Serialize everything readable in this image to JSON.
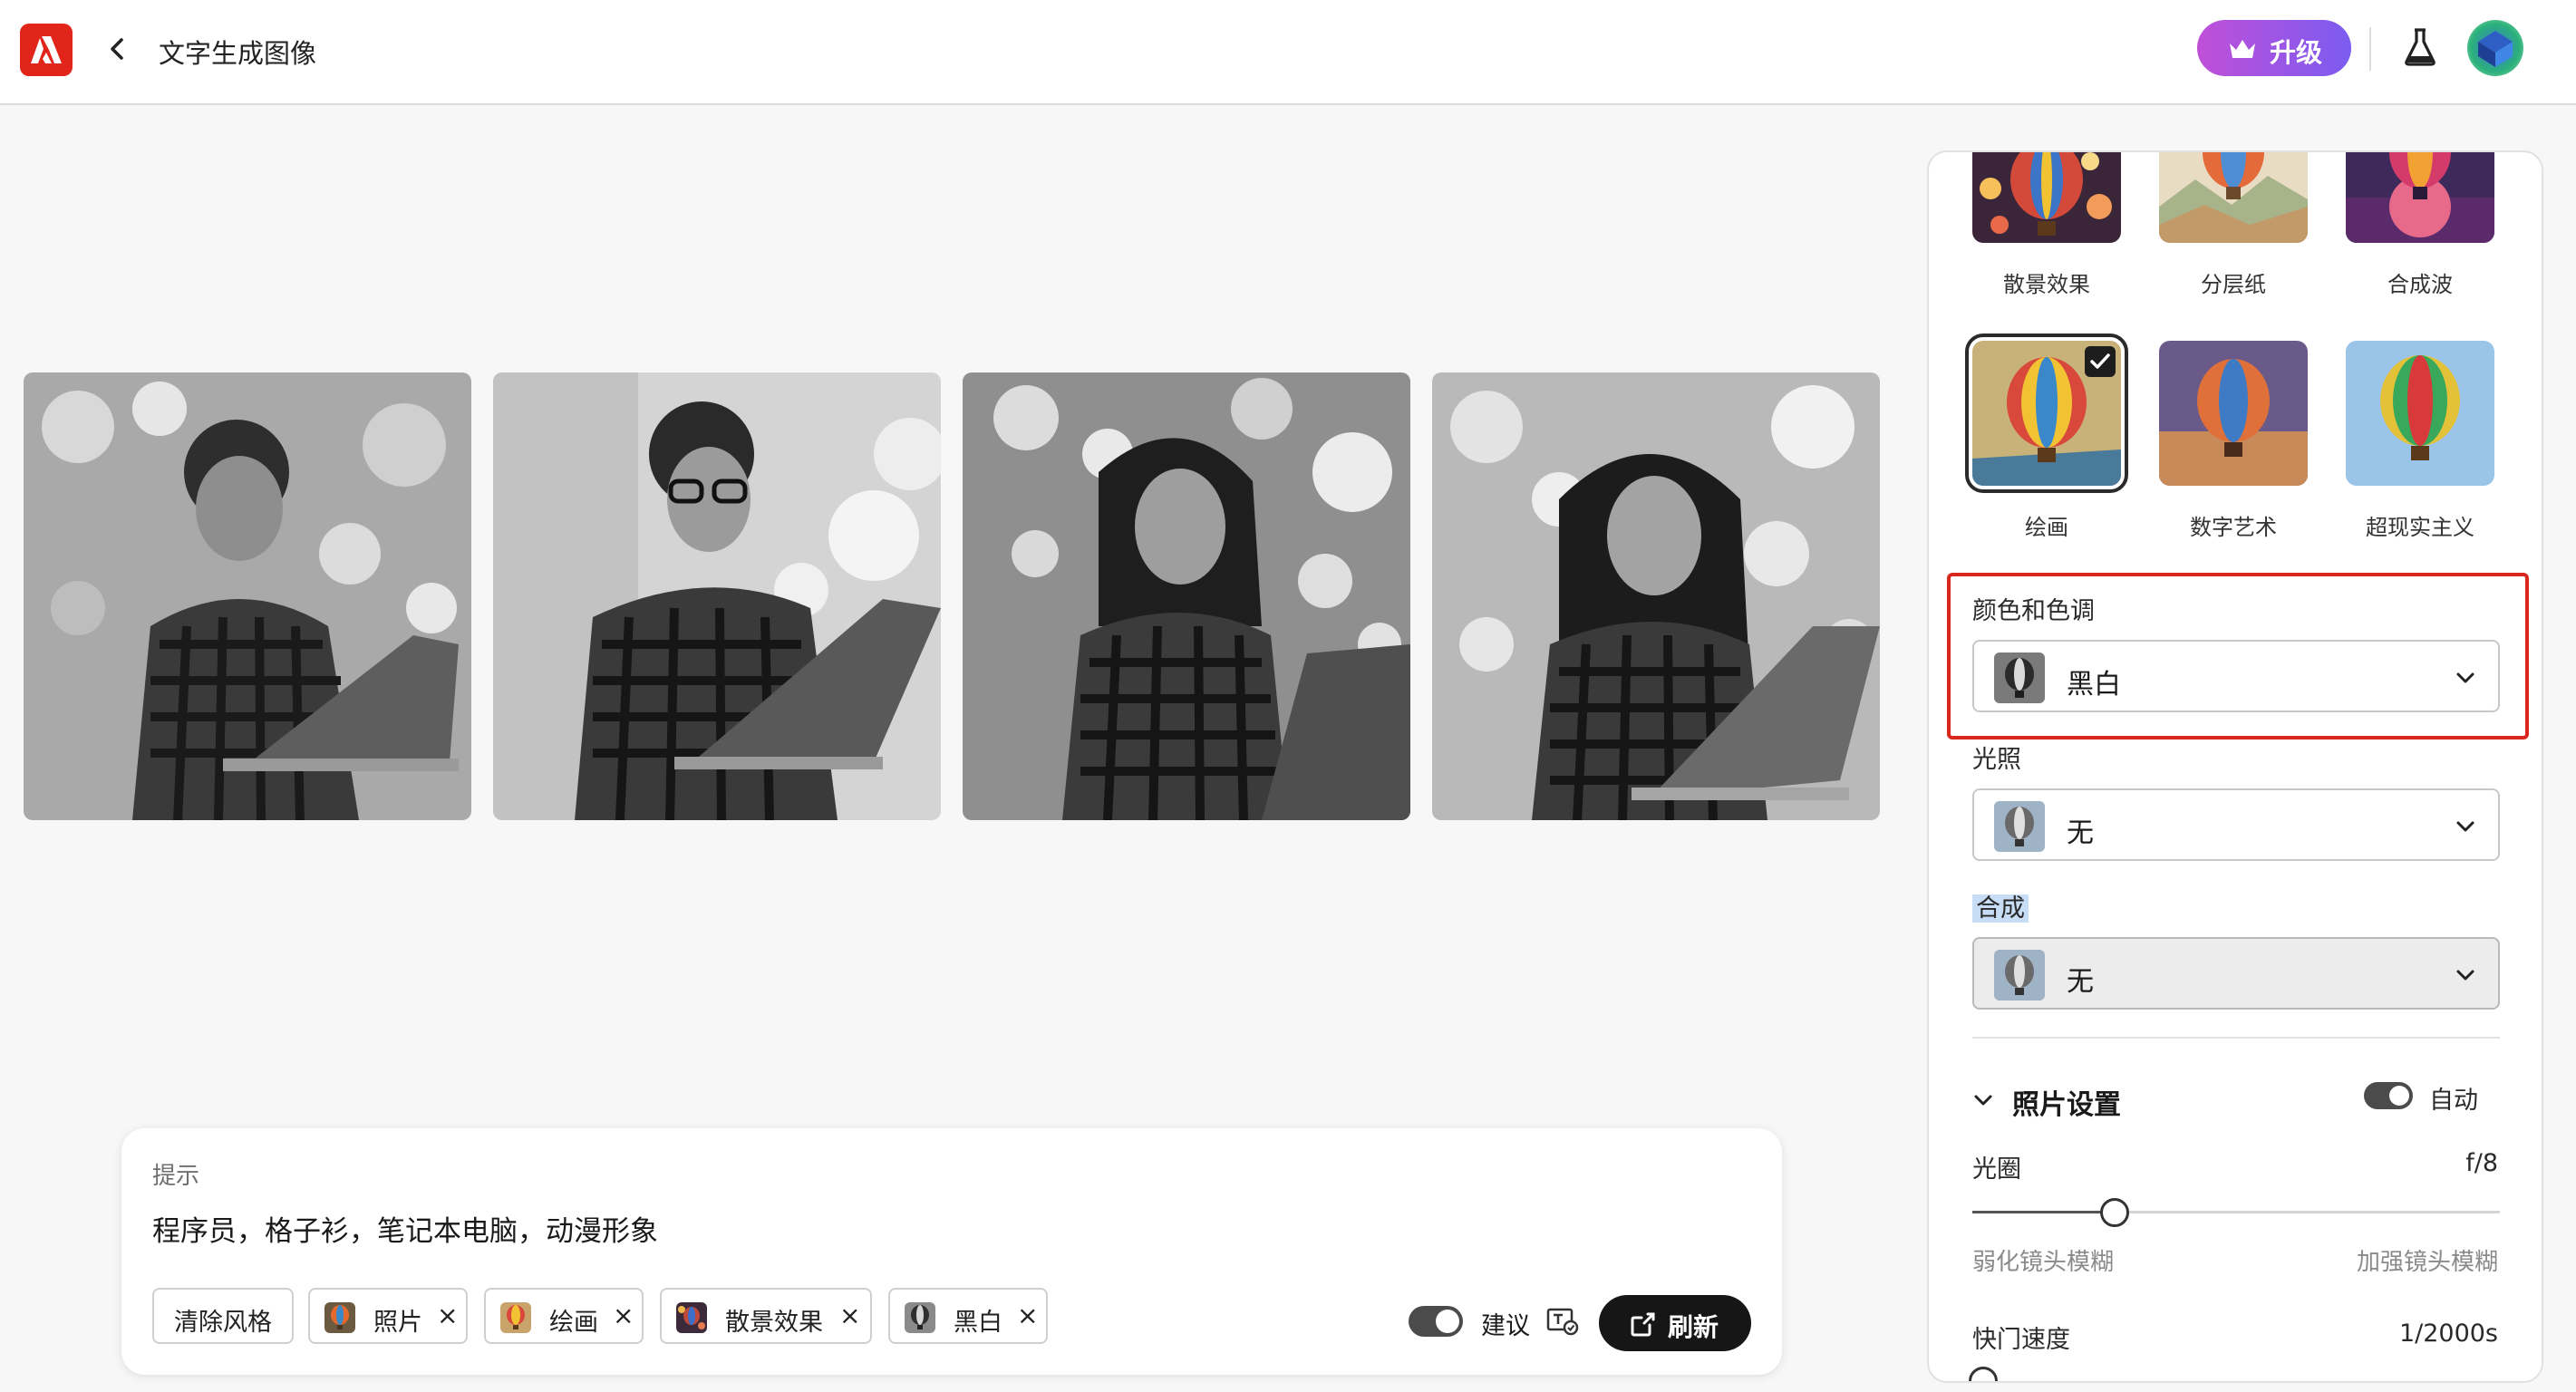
{
  "topbar": {
    "page_title": "文字生成图像",
    "upgrade_label": "升级"
  },
  "gallery": [
    {
      "name": "result-image-1",
      "tone": "black-and-white",
      "subject": "man-laptop"
    },
    {
      "name": "result-image-2",
      "tone": "black-and-white",
      "subject": "man-glasses-laptop"
    },
    {
      "name": "result-image-3",
      "tone": "black-and-white",
      "subject": "woman-laptop"
    },
    {
      "name": "result-image-4",
      "tone": "black-and-white",
      "subject": "woman-laptop"
    }
  ],
  "prompt": {
    "label": "提示",
    "text": "程序员，格子衫，笔记本电脑，动漫形象",
    "clear_styles_label": "清除风格",
    "chips": [
      {
        "label": "照片",
        "remove": "×"
      },
      {
        "label": "绘画",
        "remove": "×"
      },
      {
        "label": "散景效果",
        "remove": "×"
      },
      {
        "label": "黑白",
        "remove": "×"
      }
    ],
    "suggest_label": "建议",
    "suggest_enabled": true,
    "refresh_label": "刷新"
  },
  "side_panel": {
    "effects_row1": [
      {
        "label": "散景效果",
        "selected": false
      },
      {
        "label": "分层纸",
        "selected": false
      },
      {
        "label": "合成波",
        "selected": false
      }
    ],
    "effects_row2": [
      {
        "label": "绘画",
        "selected": true
      },
      {
        "label": "数字艺术",
        "selected": false
      },
      {
        "label": "超现实主义",
        "selected": false
      }
    ],
    "color_tone": {
      "label": "颜色和色调",
      "value": "黑白"
    },
    "lighting": {
      "label": "光照",
      "value": "无"
    },
    "composition": {
      "label": "合成",
      "value": "无"
    },
    "photo_settings": {
      "title": "照片设置",
      "auto_label": "自动",
      "auto_enabled": true,
      "aperture": {
        "label": "光圈",
        "value": "f/8",
        "min_label": "弱化镜头模糊",
        "max_label": "加强镜头模糊",
        "level": 0.27
      },
      "shutter": {
        "label": "快门速度",
        "value": "1/2000s"
      }
    }
  },
  "colors": {
    "accent_red": "#d9261c",
    "upgrade_gradient_start": "#c04fd8",
    "upgrade_gradient_end": "#7b5cf0",
    "primary_button": "#161616"
  }
}
